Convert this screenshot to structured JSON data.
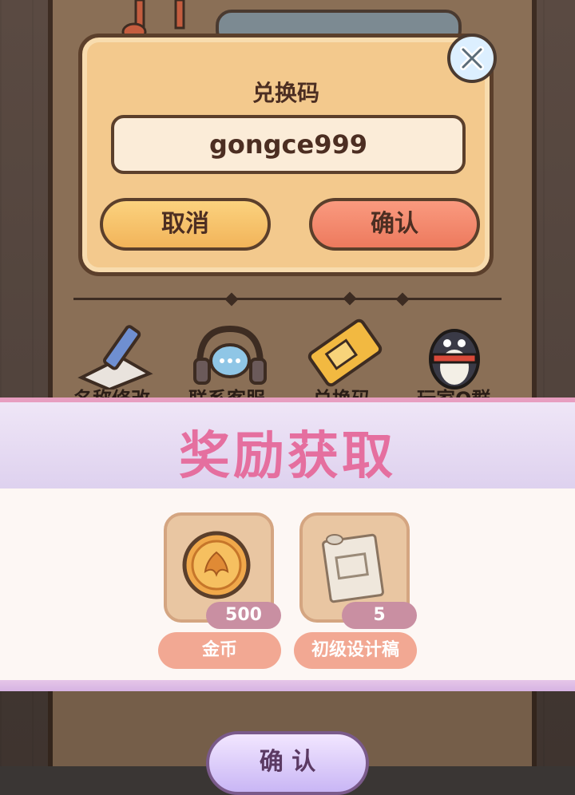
{
  "redeem_dialog": {
    "title": "兑换码",
    "code_value": "gongce999",
    "cancel_label": "取消",
    "confirm_label": "确认"
  },
  "settings_row": {
    "items": [
      {
        "label": "名称修改",
        "icon": "pencil-icon"
      },
      {
        "label": "联系客服",
        "icon": "headset-icon"
      },
      {
        "label": "兑换码",
        "icon": "ticket-icon"
      },
      {
        "label": "玩家Q群",
        "icon": "penguin-icon"
      }
    ]
  },
  "reward_popup": {
    "title": "奖励获取",
    "items": [
      {
        "quantity": "500",
        "name": "金币",
        "icon": "gold-coin-icon"
      },
      {
        "quantity": "5",
        "name": "初级设计稿",
        "icon": "blueprint-scroll-icon"
      }
    ],
    "confirm_label": "确 认"
  },
  "colors": {
    "modal_bg": "#f3c98d",
    "cancel_btn": "#f2b45a",
    "confirm_btn": "#ed7a5e",
    "reward_title": "#e56f9f",
    "qty_badge": "#c98fa2",
    "name_pill": "#f2a893"
  }
}
